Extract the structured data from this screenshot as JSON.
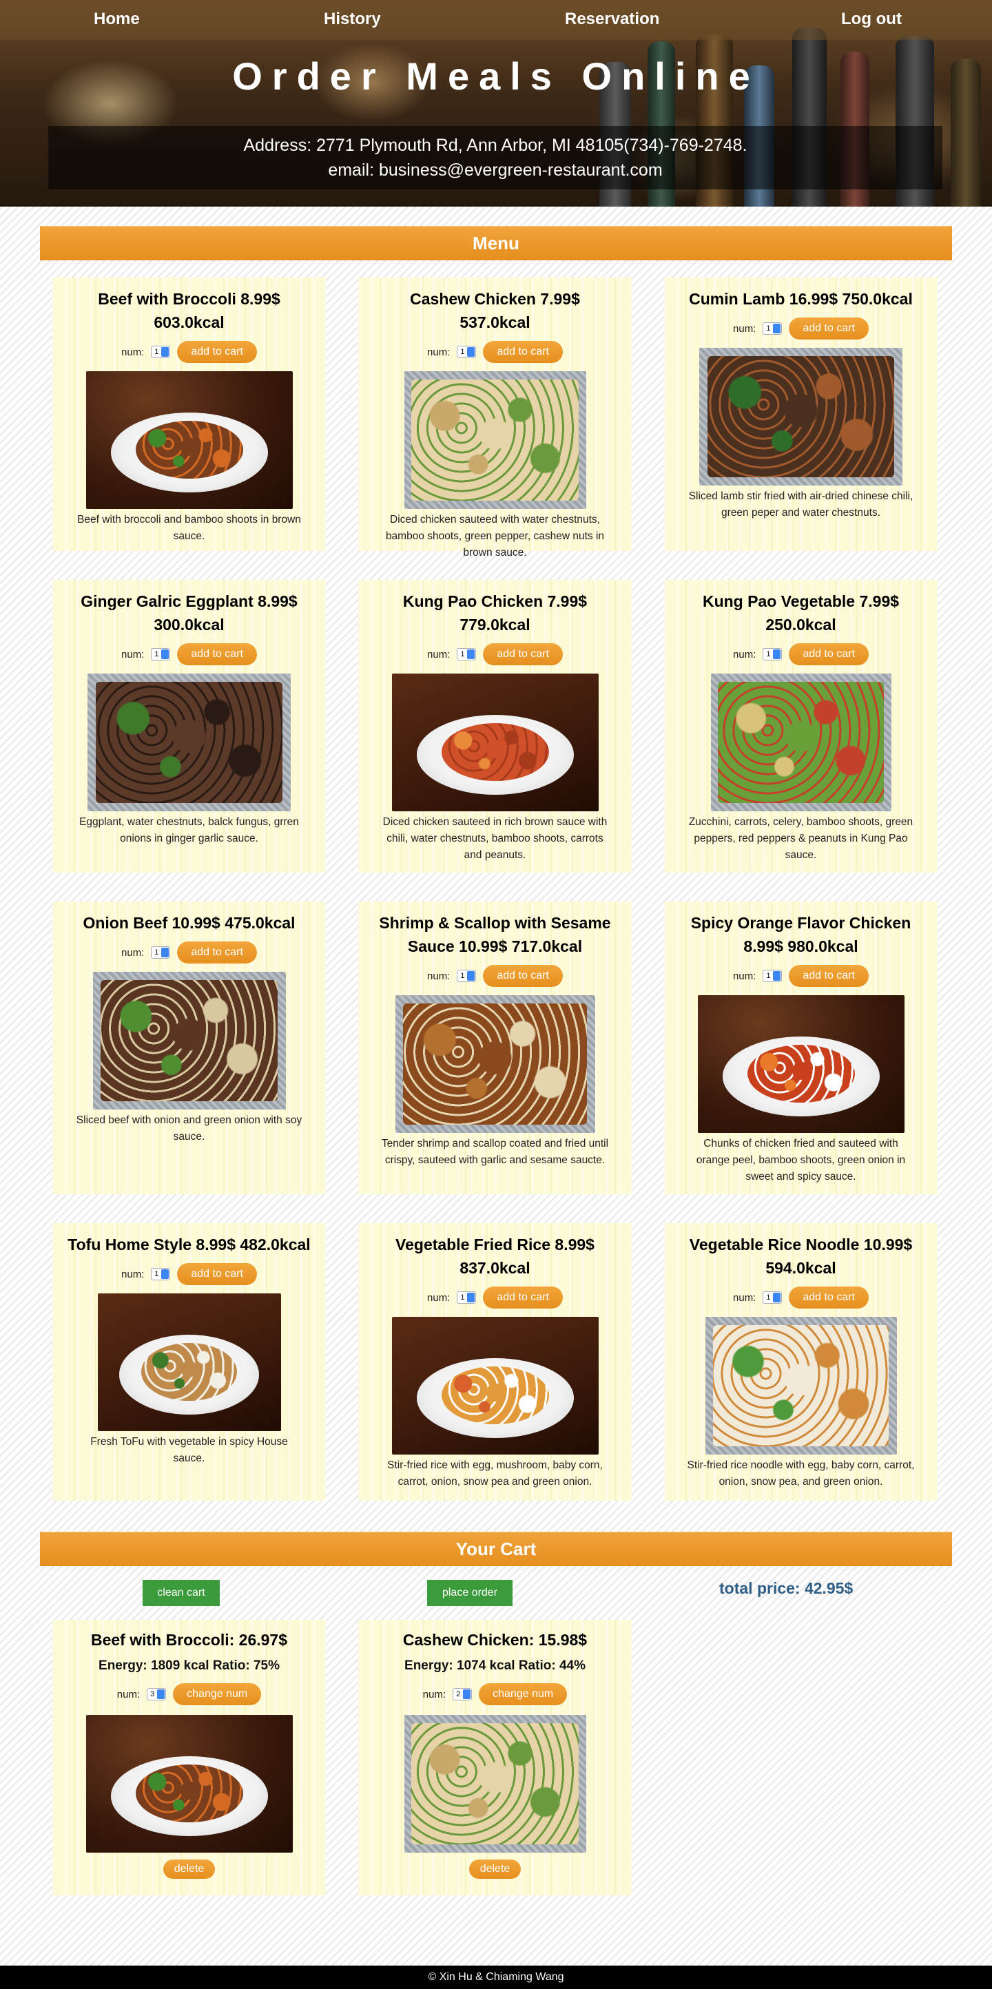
{
  "nav": {
    "home": "Home",
    "history": "History",
    "reservation": "Reservation",
    "logout": "Log out"
  },
  "hero": {
    "title": "Order Meals Online",
    "address": "Address: 2771 Plymouth Rd, Ann Arbor, MI 48105(734)-769-2748.",
    "email": "email: business@evergreen-restaurant.com"
  },
  "menu": {
    "heading": "Menu",
    "num_label": "num:",
    "default_num": "1",
    "add_label": "add to cart",
    "items": [
      {
        "title": "Beef with Broccoli 8.99$ 603.0kcal",
        "desc": "Beef with broccoli and bamboo shoots in brown sauce.",
        "image": "beef-broccoli-photo"
      },
      {
        "title": "Cashew Chicken 7.99$ 537.0kcal",
        "desc": "Diced chicken sauteed with water chestnuts, bamboo shoots, green pepper, cashew nuts in brown sauce.",
        "image": "cashew-chicken-photo"
      },
      {
        "title": "Cumin Lamb 16.99$ 750.0kcal",
        "desc": "Sliced lamb stir fried with air-dried chinese chili, green peper and water chestnuts.",
        "image": "cumin-lamb-photo"
      },
      {
        "title": "Ginger Galric Eggplant 8.99$ 300.0kcal",
        "desc": "Eggplant, water chestnuts, balck fungus, grren onions in ginger garlic sauce.",
        "image": "eggplant-photo"
      },
      {
        "title": "Kung Pao Chicken 7.99$ 779.0kcal",
        "desc": "Diced chicken sauteed in rich brown sauce with chili, water chestnuts, bamboo shoots, carrots and peanuts.",
        "image": "kung-pao-chicken-photo"
      },
      {
        "title": "Kung Pao Vegetable 7.99$ 250.0kcal",
        "desc": "Zucchini, carrots, celery, bamboo shoots, green peppers, red peppers & peanuts in Kung Pao sauce.",
        "image": "kung-pao-vegetable-photo"
      },
      {
        "title": "Onion Beef 10.99$ 475.0kcal",
        "desc": "Sliced beef with onion and green onion with soy sauce.",
        "image": "onion-beef-photo"
      },
      {
        "title": "Shrimp & Scallop with Sesame Sauce 10.99$ 717.0kcal",
        "desc": "Tender shrimp and scallop coated and fried until crispy, sauteed with garlic and sesame saucte.",
        "image": "shrimp-scallop-photo"
      },
      {
        "title": "Spicy Orange Flavor Chicken 8.99$ 980.0kcal",
        "desc": "Chunks of chicken fried and sauteed with orange peel, bamboo shoots, green onion in sweet and spicy sauce.",
        "image": "orange-chicken-photo"
      },
      {
        "title": "Tofu Home Style 8.99$ 482.0kcal",
        "desc": "Fresh ToFu with vegetable in spicy House sauce.",
        "image": "tofu-photo"
      },
      {
        "title": "Vegetable Fried Rice 8.99$ 837.0kcal",
        "desc": "Stir-fried rice with egg, mushroom, baby corn, carrot, onion, snow pea and green onion.",
        "image": "fried-rice-photo"
      },
      {
        "title": "Vegetable Rice Noodle 10.99$ 594.0kcal",
        "desc": "Stir-fried rice noodle with egg, baby corn, carrot, onion, snow pea, and green onion.",
        "image": "rice-noodle-photo"
      }
    ]
  },
  "cart": {
    "heading": "Your Cart",
    "clean_label": "clean cart",
    "place_label": "place order",
    "total": "total price: 42.95$",
    "change_label": "change num",
    "delete_label": "delete",
    "items": [
      {
        "title": "Beef with Broccoli: 26.97$",
        "energy": "Energy: 1809 kcal Ratio: 75%",
        "num": "3",
        "image": "beef-broccoli-photo"
      },
      {
        "title": "Cashew Chicken: 15.98$",
        "energy": "Energy: 1074 kcal Ratio: 44%",
        "num": "2",
        "image": "cashew-chicken-photo"
      }
    ]
  },
  "footer": {
    "text": "© Xin Hu & Chiaming Wang"
  },
  "colors": {
    "accent_orange": "#e8951f",
    "card_bg": "#fdfad6",
    "green_button": "#3b9a3b",
    "total_blue": "#2f5f86"
  }
}
